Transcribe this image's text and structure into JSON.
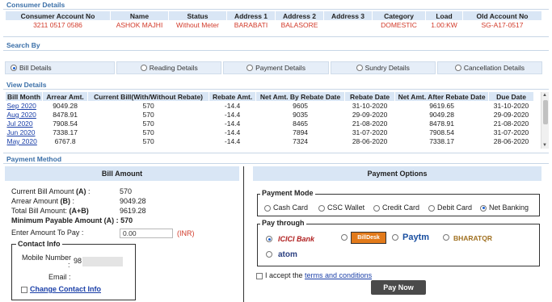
{
  "consumer": {
    "title": "Consumer Details",
    "headers": [
      "Consumer Account No",
      "Name",
      "Status",
      "Address 1",
      "Address 2",
      "Address 3",
      "Category",
      "Load",
      "Old Account No"
    ],
    "values": [
      "3211 0517 0586",
      "ASHOK MAJHI",
      "Without Meter",
      "BARABATI",
      "BALASORE",
      "",
      "DOMESTIC",
      "1.00:KW",
      "SG-A17-0517"
    ]
  },
  "search": {
    "title": "Search By",
    "tabs": [
      "Bill Details",
      "Reading Details",
      "Payment Details",
      "Sundry Details",
      "Cancellation Details"
    ],
    "selected_index": 0
  },
  "view": {
    "title": "View Details",
    "headers": [
      "Bill Month",
      "Arrear Amt.",
      "Current Bill(With/Without Rebate)",
      "Rebate Amt.",
      "Net Amt. By Rebate Date",
      "Rebate Date",
      "Net Amt. After Rebate Date",
      "Due Date"
    ],
    "rows": [
      [
        "Sep 2020",
        "9049.28",
        "570",
        "-14.4",
        "9605",
        "31-10-2020",
        "9619.65",
        "31-10-2020"
      ],
      [
        "Aug 2020",
        "8478.91",
        "570",
        "-14.4",
        "9035",
        "29-09-2020",
        "9049.28",
        "29-09-2020"
      ],
      [
        "Jul 2020",
        "7908.54",
        "570",
        "-14.4",
        "8465",
        "21-08-2020",
        "8478.91",
        "21-08-2020"
      ],
      [
        "Jun 2020",
        "7338.17",
        "570",
        "-14.4",
        "7894",
        "31-07-2020",
        "7908.54",
        "31-07-2020"
      ],
      [
        "May 2020",
        "6767.8",
        "570",
        "-14.4",
        "7324",
        "28-06-2020",
        "7338.17",
        "28-06-2020"
      ]
    ]
  },
  "payment_method": {
    "title": "Payment Method",
    "bill_amount_title": "Bill Amount",
    "current_bill_label": "Current Bill Amount ",
    "current_bill_tag": "(A)",
    "current_bill_value": "570",
    "arrear_label": "Arrear Amount ",
    "arrear_tag": "(B)",
    "arrear_value": "9049.28",
    "total_label": "Total Bill Amount: ",
    "total_tag": "(A+B)",
    "total_value": "9619.28",
    "min_payable_label": "Minimum Payable Amount (A) : 570",
    "enter_amount_label": "Enter Amount To Pay :",
    "enter_amount_value": "0.00",
    "currency": "(INR)",
    "contact_info_title": "Contact Info",
    "mobile_label": "Mobile Number",
    "mobile_value": "98",
    "email_label": "Email :",
    "change_contact_label": "Change Contact Info",
    "colon": ":"
  },
  "payment_options": {
    "title": "Payment Options",
    "mode_title": "Payment Mode",
    "modes": [
      "Cash Card",
      "CSC Wallet",
      "Credit Card",
      "Debit Card",
      "Net Banking"
    ],
    "selected_mode_index": 4,
    "pay_through_title": "Pay through",
    "gateways": [
      "ICICI Bank",
      "BillDesk",
      "Paytm",
      "BHARATQR",
      "atom"
    ],
    "selected_gateway_index": 0,
    "accept_prefix": "I accept the ",
    "terms_label": "terms and conditions",
    "pay_now_label": "Pay Now"
  },
  "colors": {
    "section_title": "#3a6fa8",
    "header_bg": "#d9e6f5",
    "accent_red": "#d23a2a",
    "link": "#1a3fa8"
  }
}
